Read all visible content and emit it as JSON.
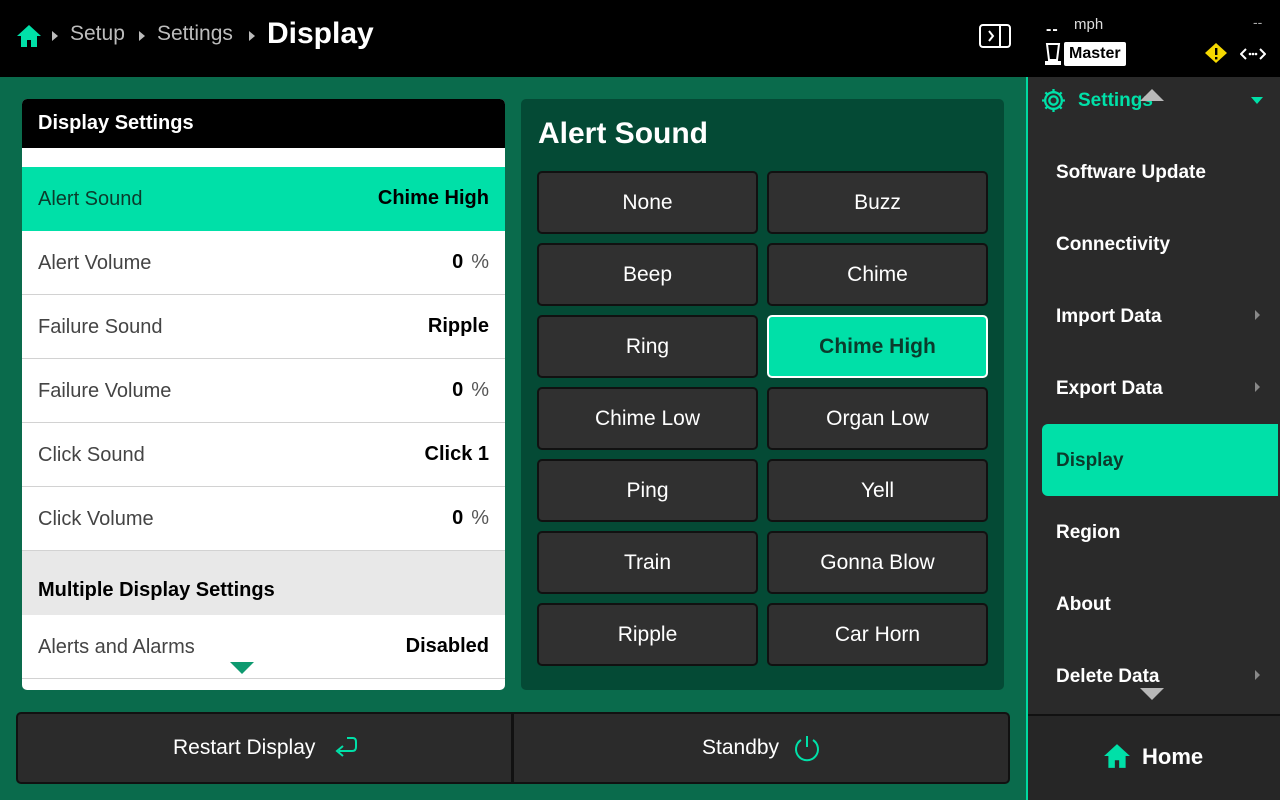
{
  "topbar": {
    "breadcrumbs": [
      "Setup",
      "Settings"
    ],
    "current": "Display",
    "speed_dash": "--",
    "speed_unit": "mph",
    "right_dash": "--",
    "role_badge": "Master"
  },
  "display_settings": {
    "title": "Display Settings",
    "rows": [
      {
        "label": "Alert Sound",
        "value": "Chime High",
        "unit": "",
        "selected": true
      },
      {
        "label": "Alert Volume",
        "value": "0",
        "unit": "%"
      },
      {
        "label": "Failure Sound",
        "value": "Ripple",
        "unit": ""
      },
      {
        "label": "Failure Volume",
        "value": "0",
        "unit": "%"
      },
      {
        "label": "Click Sound",
        "value": "Click 1",
        "unit": ""
      },
      {
        "label": "Click Volume",
        "value": "0",
        "unit": "%"
      }
    ],
    "group_title": "Multiple Display Settings",
    "group_rows": [
      {
        "label": "Alerts and Alarms",
        "value": "Disabled"
      }
    ]
  },
  "alert_sound": {
    "title": "Alert Sound",
    "options": [
      "None",
      "Buzz",
      "Beep",
      "Chime",
      "Ring",
      "Chime High",
      "Chime Low",
      "Organ Low",
      "Ping",
      "Yell",
      "Train",
      "Gonna Blow",
      "Ripple",
      "Car Horn"
    ],
    "selected": "Chime High"
  },
  "bottom": {
    "restart_label": "Restart Display",
    "standby_label": "Standby"
  },
  "sidebar": {
    "header": "Settings",
    "items": [
      {
        "label": "Software Update",
        "chevron": false
      },
      {
        "label": "Connectivity",
        "chevron": false
      },
      {
        "label": "Import Data",
        "chevron": true
      },
      {
        "label": "Export Data",
        "chevron": true
      },
      {
        "label": "Display",
        "chevron": false,
        "selected": true
      },
      {
        "label": "Region",
        "chevron": false
      },
      {
        "label": "About",
        "chevron": false
      },
      {
        "label": "Delete Data",
        "chevron": true
      }
    ],
    "home_label": "Home"
  },
  "colors": {
    "accent": "#00e0a8",
    "background": "#0a6b4c",
    "panel_dark": "#044a35",
    "warning": "#f5d800"
  }
}
